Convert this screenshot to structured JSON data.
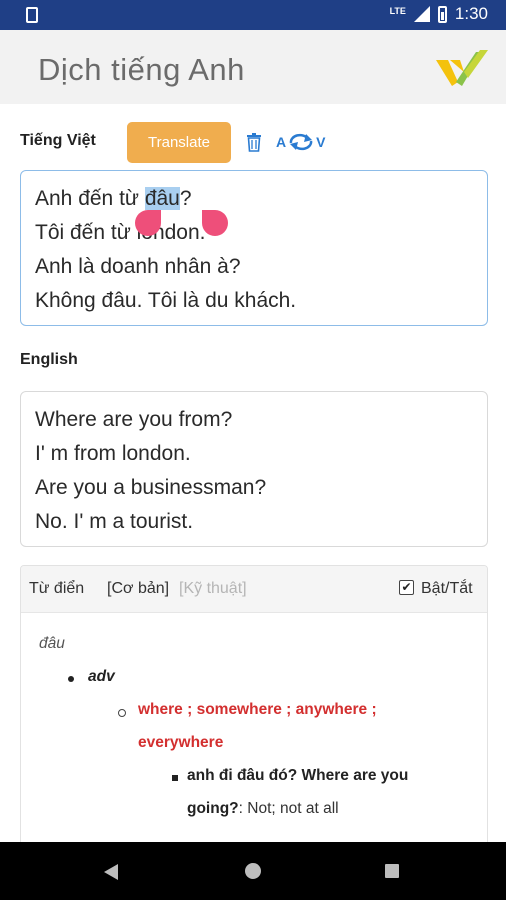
{
  "status_bar": {
    "network": "LTE",
    "time": "1:30"
  },
  "app_bar": {
    "title": "Dịch tiếng Anh",
    "logo_icon": "yellow-green-check-logo"
  },
  "source": {
    "label": "Tiếng Việt",
    "translate_label": "Translate",
    "swap": {
      "from": "A",
      "to": "V"
    },
    "lines": [
      {
        "before": "Anh đến từ ",
        "selected": "đâu",
        "after": "?"
      },
      {
        "text": "Tôi đến từ london."
      },
      {
        "text": "Anh là doanh nhân à?"
      },
      {
        "text": "Không đâu. Tôi là du khách."
      }
    ]
  },
  "target": {
    "label": "English",
    "lines": [
      "Where are you from?",
      "I' m from london.",
      "Are you a businessman?",
      "No. I' m a tourist."
    ]
  },
  "dictionary": {
    "title": "Từ điển",
    "mode_basic": "[Cơ bản]",
    "mode_technical": "[Kỹ thuật]",
    "toggle_label": "Bật/Tắt",
    "toggle_checked": true,
    "word": "đâu",
    "part_of_speech": "adv",
    "meaning_line1": "where ; somewhere ; anywhere ;",
    "meaning_line2": "everywhere",
    "example_line1": "anh đi đâu đó? Where are you",
    "example_bold2": "going?",
    "example_rest2": ": Not; not at all"
  },
  "colors": {
    "accent": "#f0ad4e",
    "status_bar": "#1f3f86",
    "meaning": "#d32f2f",
    "link": "#2a7bd1"
  }
}
